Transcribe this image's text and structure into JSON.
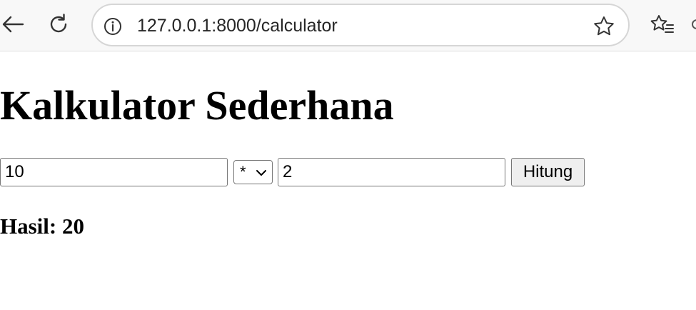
{
  "browser": {
    "url": "127.0.0.1:8000/calculator",
    "icons": {
      "back": "back-arrow-icon",
      "reload": "reload-icon",
      "site_info": "info-icon",
      "favorite": "star-icon",
      "favorites": "favorites-icon"
    }
  },
  "page": {
    "title": "Kalkulator Sederhana",
    "form": {
      "first_number": "10",
      "operator": "*",
      "second_number": "2",
      "submit_label": "Hitung"
    },
    "result": {
      "label": "Hasil:",
      "value": "20"
    }
  },
  "colors": {
    "toolbar_bg": "#f8f8f8",
    "page_bg": "#ffffff",
    "text": "#000000",
    "button_bg": "#efefef",
    "input_border": "#767676"
  }
}
